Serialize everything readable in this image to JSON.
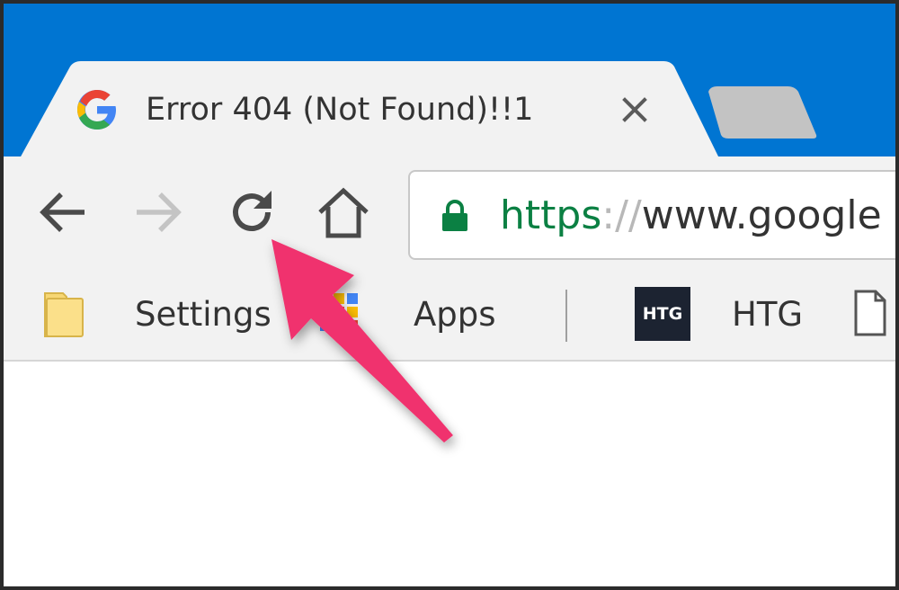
{
  "tab": {
    "title": "Error 404 (Not Found)!!1"
  },
  "address_bar": {
    "scheme": "https",
    "separator": "://",
    "host": "www.google"
  },
  "bookmarks": [
    {
      "label": "Settings",
      "icon": "folder-icon"
    },
    {
      "label": "Apps",
      "icon": "apps-grid-icon"
    },
    {
      "label": "HTG",
      "icon": "htg-logo",
      "logo_text": "HTG"
    }
  ],
  "colors": {
    "title_bar": "#0075d2",
    "toolbar": "#f2f2f2",
    "secure_green": "#0b8043",
    "callout_arrow": "#f0336e",
    "htg_logo_bg": "#1c2331"
  },
  "icons": {
    "back": "arrow-left-icon",
    "forward": "arrow-right-icon",
    "reload": "reload-icon",
    "home": "home-icon",
    "lock": "lock-icon",
    "close": "close-icon",
    "page": "page-icon"
  }
}
